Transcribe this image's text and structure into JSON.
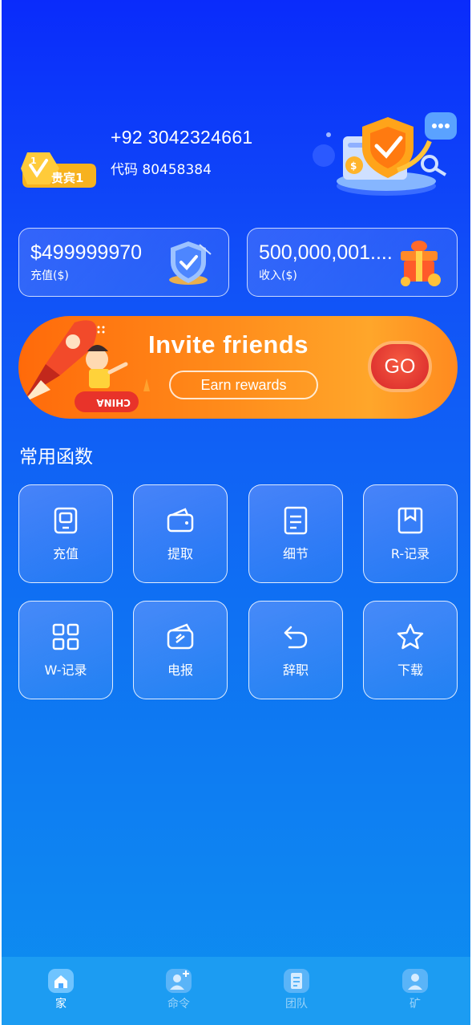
{
  "user": {
    "vip_badge_text": "贵宾1",
    "vip_level": "1",
    "phone": "+92 3042324661",
    "code": "代码 80458384"
  },
  "balances": {
    "recharge": {
      "amount": "$499999970",
      "label": "充值($)"
    },
    "income": {
      "amount": "500,000,001....",
      "label": "收入($)"
    }
  },
  "banner": {
    "title": "Invite friends",
    "subtitle": "Earn rewards",
    "go_label": "GO",
    "rocket_text": "CHINA"
  },
  "section_title": "常用函数",
  "functions": [
    {
      "label": "充值",
      "icon": "phone-icon"
    },
    {
      "label": "提取",
      "icon": "wallet-icon"
    },
    {
      "label": "细节",
      "icon": "document-icon"
    },
    {
      "label": "R-记录",
      "icon": "bookmark-icon"
    },
    {
      "label": "W-记录",
      "icon": "grid-icon"
    },
    {
      "label": "电报",
      "icon": "telegram-icon"
    },
    {
      "label": "辞职",
      "icon": "undo-icon"
    },
    {
      "label": "下载",
      "icon": "star-icon"
    }
  ],
  "tabbar": {
    "items": [
      {
        "label": "家",
        "icon": "home-icon",
        "active": true
      },
      {
        "label": "命令",
        "icon": "add-user-icon",
        "active": false
      },
      {
        "label": "团队",
        "icon": "team-icon",
        "active": false
      },
      {
        "label": "矿",
        "icon": "profile-icon",
        "active": false
      }
    ]
  },
  "colors": {
    "bg_top": "#0a2bfb",
    "bg_bottom": "#0d8ff0",
    "banner_orange": "#ff7a12",
    "go_red": "#d8262a",
    "tabbar": "#1c9cf2"
  }
}
